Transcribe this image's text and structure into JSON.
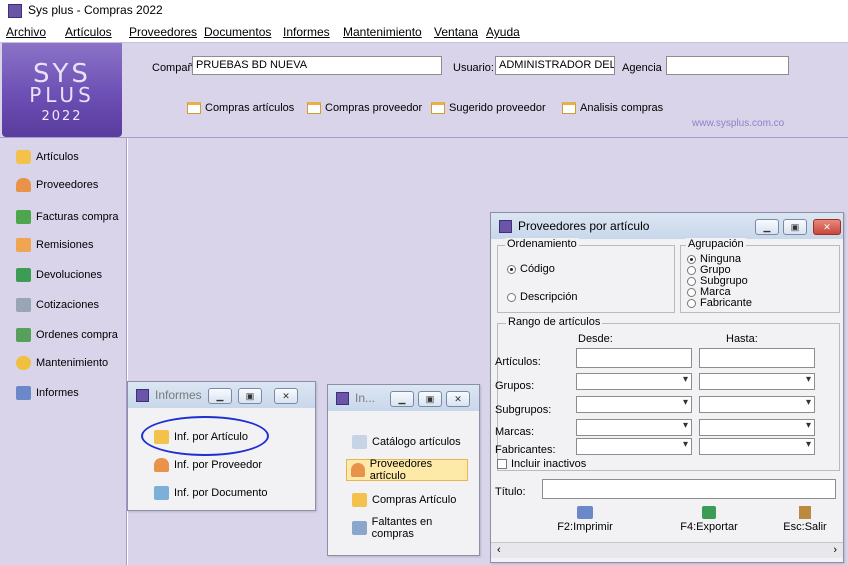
{
  "app": {
    "title": "Sys plus - Compras 2022"
  },
  "menu": [
    "Archivo",
    "Artículos",
    "Proveedores",
    "Documentos",
    "Informes",
    "Mantenimiento",
    "Ventana",
    "Ayuda"
  ],
  "logo": {
    "line1": "SYS",
    "line2": "PLUS",
    "year": "2022"
  },
  "header": {
    "company_label": "Compañía:",
    "company_value": "PRUEBAS BD NUEVA",
    "user_label": "Usuario:",
    "user_value": "ADMINISTRADOR DEL",
    "agency_label": "Agencia",
    "agency_value": ""
  },
  "toolbar": [
    "Compras artículos",
    "Compras proveedor",
    "Sugerido proveedor",
    "Analisis compras"
  ],
  "website": "www.sysplus.com.co",
  "sidebar": [
    "Artículos",
    "Proveedores",
    "Facturas compra",
    "Remisiones",
    "Devoluciones",
    "Cotizaciones",
    "Ordenes compra",
    "Mantenimiento",
    "Informes"
  ],
  "informes_window": {
    "title": "Informes",
    "items": [
      "Inf. por Artículo",
      "Inf. por Proveedor",
      "Inf. por Documento"
    ]
  },
  "in_window": {
    "title": "In...",
    "items": [
      "Catálogo artículos",
      "Proveedores artículo",
      "Compras Artículo",
      "Faltantes en compras"
    ]
  },
  "prov_window": {
    "title": "Proveedores por artículo",
    "ordenamiento": {
      "title": "Ordenamiento",
      "options": [
        "Código",
        "Descripción"
      ],
      "selected": "Código"
    },
    "agrupacion": {
      "title": "Agrupación",
      "options": [
        "Ninguna",
        "Grupo",
        "Subgrupo",
        "Marca",
        "Fabricante"
      ],
      "selected": "Ninguna"
    },
    "rango": {
      "title": "Rango de artículos",
      "desde": "Desde:",
      "hasta": "Hasta:",
      "rows": [
        "Artículos:",
        "Grupos:",
        "Subgrupos:",
        "Marcas:",
        "Fabricantes:"
      ]
    },
    "incluir_inactivos": "Incluir inactivos",
    "titulo_label": "Título:",
    "titulo_value": "",
    "buttons": [
      "F2:Imprimir",
      "F4:Exportar",
      "Esc:Salir"
    ]
  },
  "colors": {
    "background": "#d9d4ea",
    "accent": "#6d4fb5",
    "highlight": "#fde9a8",
    "circle": "#1f2fd1"
  }
}
